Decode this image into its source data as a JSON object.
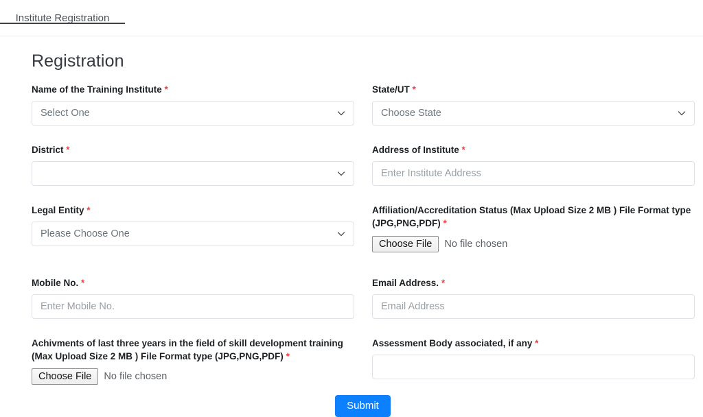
{
  "tab": {
    "label": "Institute Registration"
  },
  "page": {
    "title": "Registration"
  },
  "fields": {
    "institute_name": {
      "label": "Name of the Training Institute",
      "required_mark": "*",
      "value": "Select One"
    },
    "state_ut": {
      "label": "State/UT",
      "required_mark": "*",
      "value": "Choose State"
    },
    "district": {
      "label": "District",
      "required_mark": "*",
      "value": ""
    },
    "address": {
      "label": "Address of Institute",
      "required_mark": "*",
      "value": "",
      "placeholder": "Enter Institute Address"
    },
    "legal_entity": {
      "label": "Legal Entity",
      "required_mark": "*",
      "value": "Please Choose One"
    },
    "affiliation_file": {
      "label": "Affiliation/Accreditation Status (Max Upload Size 2 MB ) File Format type (JPG,PNG,PDF)",
      "required_mark": "*",
      "button_label": "Choose File",
      "file_status": "No file chosen"
    },
    "mobile": {
      "label": "Mobile No.",
      "required_mark": "*",
      "value": "",
      "placeholder": "Enter Mobile No."
    },
    "email": {
      "label": "Email Address.",
      "required_mark": "*",
      "value": "",
      "placeholder": "Email Address"
    },
    "achievements_file": {
      "label": "Achivments of last three years in the field of skill development training (Max Upload Size 2 MB ) File Format type (JPG,PNG,PDF)",
      "required_mark": "*",
      "button_label": "Choose File",
      "file_status": "No file chosen"
    },
    "assessment_body": {
      "label": "Assessment Body associated, if any",
      "required_mark": "*",
      "value": "",
      "placeholder": ""
    }
  },
  "actions": {
    "submit_label": "Submit"
  },
  "colors": {
    "accent": "#0d80ff",
    "required": "#fa3c3c",
    "border": "#dee2e6",
    "tab_underline": "#404346"
  }
}
